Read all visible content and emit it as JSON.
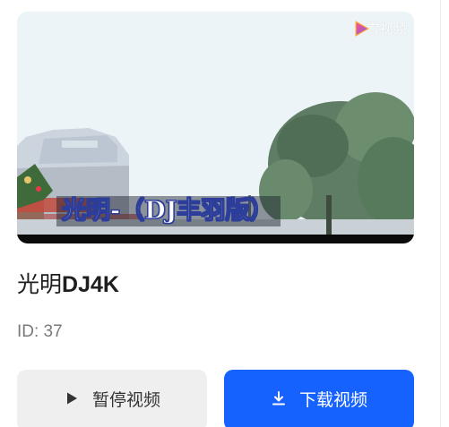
{
  "video": {
    "brand_icon": "video-app-logo",
    "brand_text": "小雪视频",
    "subtitle": "光明-（DJ丰羽版）",
    "colors": {
      "subtitle_fill": "#ffffff",
      "subtitle_stroke": "#2c3c9c"
    }
  },
  "song": {
    "title_cn": "光明",
    "title_latin": "DJ4K",
    "id_text": "ID: 37"
  },
  "buttons": {
    "pause": {
      "icon": "play-icon",
      "label": "暂停视频"
    },
    "download": {
      "icon": "download-icon",
      "label": "下载视频"
    }
  },
  "colors": {
    "accent": "#1662ff",
    "secondary_button": "#efefef",
    "text_primary": "#1f1f1f",
    "text_muted": "#7a7a7a"
  }
}
